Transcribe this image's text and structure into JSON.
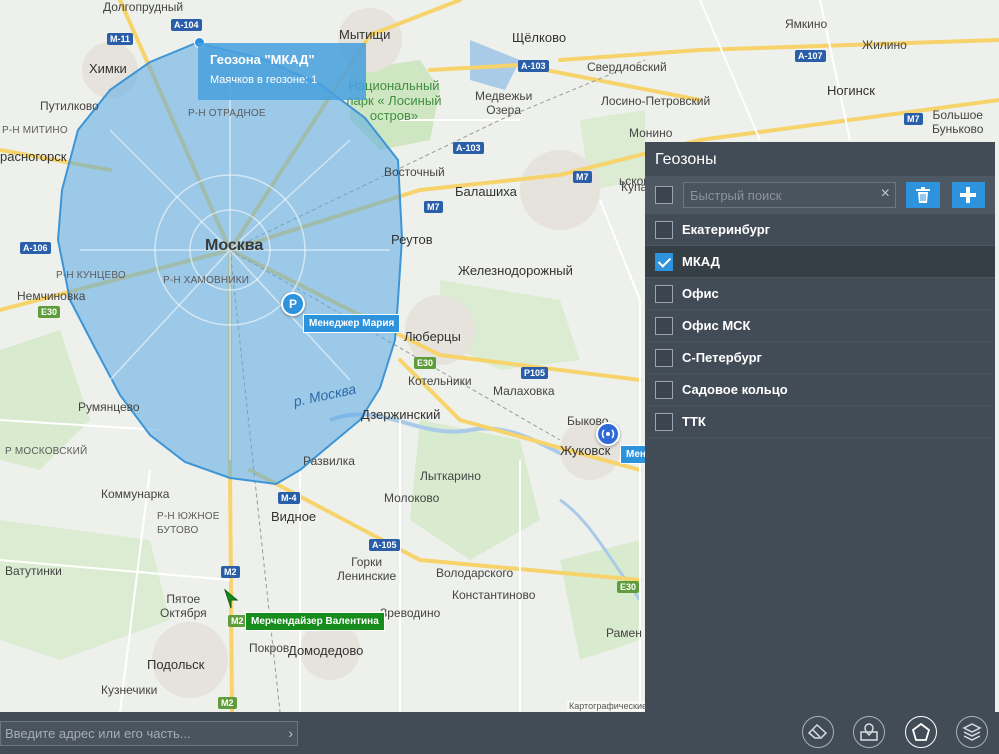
{
  "map": {
    "cities": {
      "moscow": "Москва",
      "khimki": "Химки",
      "mytishchi": "Мытищи",
      "shchyolkovo": "Щёлково",
      "balashikha": "Балашиха",
      "reutov": "Реутов",
      "zheleznodorozhny": "Железнодорожный",
      "lyubertsy": "Люберцы",
      "dzerzhinsky": "Дзержинский",
      "zhukovsky": "Жуковск",
      "vidnoe": "Видное",
      "podolsk": "Подольск",
      "domodedovo": "Домодедово",
      "noginsk": "Ногинск",
      "krasnogorsk": "расногорск",
      "dolgoprudny": "Долгопрудный",
      "sverdlovsky": "Свердловский",
      "losino": "Лосино-Петровский",
      "monino": "Монино",
      "medvezhi": "Медвежьи\nОзера",
      "putilkovo": "Путилково",
      "nemchinovka": "Немчиновка",
      "rumyantsevo": "Румянцево",
      "kommunarka": "Коммунарка",
      "vatutinki": "Ватутинки",
      "pyatoe": "Пятое\nОктября",
      "pokrov": "Покров",
      "kuznechiki": "Кузнечики",
      "molokovo": "Молоково",
      "lytkarino": "Лыткарино",
      "malakhovka": "Малаховка",
      "kotelniki": "Котельники",
      "razvilka": "Развилка",
      "vostochny": "Восточный",
      "bykovo": "Быково",
      "gorki": "Горки\nЛенинские",
      "volodarskogo": "Володарского",
      "konstantinovo": "Константиново",
      "predovino": "Зреводино",
      "yamkino": "Ямкино",
      "zhilino": "Жилино",
      "bolshoe": "Большое\nБуньково",
      "kupa": "Купа",
      "ramen": "Рамен",
      "krasnoznamensk": "ьсково"
    },
    "districts": {
      "otradnoe": "Р-Н ОТРАДНОЕ",
      "mitino": "Р-Н МИТИНО",
      "kuntsevo": "Р-Н КУНЦЕВО",
      "khamovniki": "Р-Н ХАМОВНИКИ",
      "moskovsky": "Р МОСКОВСКИЙ",
      "yuzhnoe_butovo": "Р-Н ЮЖНОЕ\nБУТОВО"
    },
    "park": "Национальный парк « Лосиный остров»",
    "river": "р. Москва",
    "shields": {
      "a104": "А-104",
      "m11": "М-11",
      "a103a": "А-103",
      "a107": "А-107",
      "a103b": "А-103",
      "m7a": "М7",
      "m7b": "М7",
      "m7c": "М7",
      "a106": "А-106",
      "e30a": "Е30",
      "e30b": "Е30",
      "e30c": "Е30",
      "p105": "Р105",
      "m4": "М-4",
      "a105": "А-105",
      "m2a": "М2",
      "m2b": "М2",
      "m2c": "М2"
    },
    "geozone_tooltip": {
      "title": "Геозона \"МКАД\"",
      "subtitle": "Маячков в геозоне: 1"
    },
    "markers": {
      "parking_letter": "P",
      "manager_maria": "Менеджер Мария",
      "merchandiser": "Мерчендайзер Валентина",
      "manager_partial": "Менед"
    },
    "copyright": "Картографические"
  },
  "panel": {
    "title": "Геозоны",
    "search_placeholder": "Быстрый поиск",
    "clear_glyph": "×",
    "items": [
      {
        "label": "Екатеринбург",
        "checked": false
      },
      {
        "label": "МКАД",
        "checked": true
      },
      {
        "label": "Офис",
        "checked": false
      },
      {
        "label": "Офис МСК",
        "checked": false
      },
      {
        "label": "С-Петербург",
        "checked": false
      },
      {
        "label": "Садовое кольцо",
        "checked": false
      },
      {
        "label": "ТТК",
        "checked": false
      }
    ]
  },
  "bottom": {
    "address_placeholder": "Введите адрес или его часть...",
    "go_glyph": "›"
  },
  "colors": {
    "panel_bg": "#424c56",
    "accent": "#2e93dd",
    "geozone_fill": "#5aa9e3",
    "merchandiser_green": "#168c1d"
  }
}
